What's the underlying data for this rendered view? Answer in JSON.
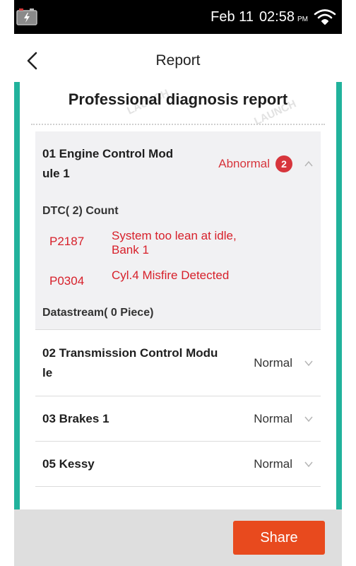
{
  "status_bar": {
    "date": "Feb 11",
    "time": "02:58",
    "ampm": "PM",
    "icons": [
      "battery-charging-icon",
      "wifi-icon"
    ]
  },
  "header": {
    "title": "Report",
    "back_icon": "chevron-left-icon"
  },
  "report": {
    "title": "Professional diagnosis report",
    "watermark": "LAUNCH"
  },
  "modules": {
    "expanded": {
      "name": "01 Engine Control Module 1",
      "status": "Abnormal",
      "badge_count": "2",
      "dtc_count_label": "DTC( 2) Count",
      "dtcs": [
        {
          "code": "P2187",
          "description": "System too lean at idle, Bank 1"
        },
        {
          "code": "P0304",
          "description": "Cyl.4 Misfire Detected"
        }
      ],
      "datastream_label": "Datastream( 0 Piece)"
    },
    "items": [
      {
        "name": "02 Transmission Control Module",
        "status": "Normal"
      },
      {
        "name": "03 Brakes 1",
        "status": "Normal"
      },
      {
        "name": "05 Kessy",
        "status": "Normal"
      }
    ]
  },
  "footer": {
    "share_label": "Share"
  },
  "colors": {
    "frame": "#21b29c",
    "abnormal": "#d7353c",
    "dtc_text": "#d7202a",
    "share_button": "#e84a1e"
  }
}
